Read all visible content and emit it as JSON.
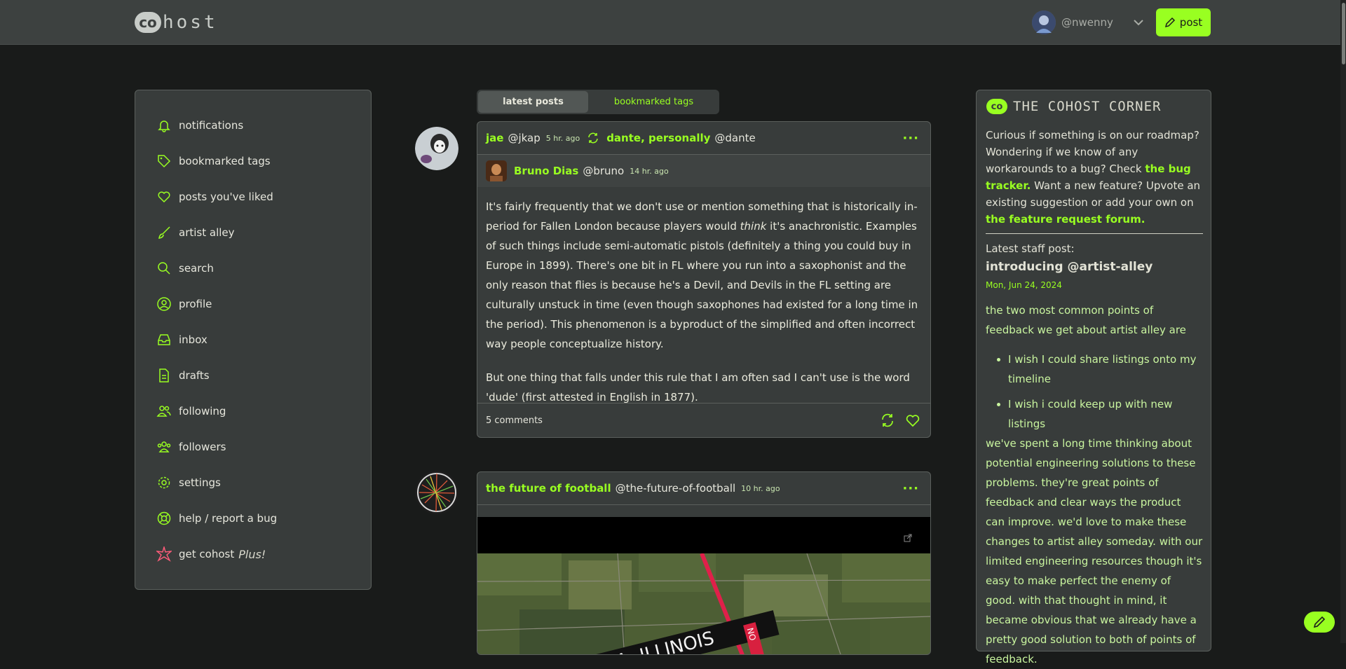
{
  "topbar": {
    "logo_mark": "co",
    "logo_word": "host",
    "username": "@nwenny",
    "post_button": "post"
  },
  "sidebar": {
    "items": [
      {
        "label": "notifications",
        "icon": "bell-icon"
      },
      {
        "label": "bookmarked tags",
        "icon": "tag-icon"
      },
      {
        "label": "posts you've liked",
        "icon": "heart-icon"
      },
      {
        "label": "artist alley",
        "icon": "paintbrush-icon"
      },
      {
        "label": "search",
        "icon": "search-icon"
      },
      {
        "label": "profile",
        "icon": "user-circle-icon"
      },
      {
        "label": "inbox",
        "icon": "inbox-icon"
      },
      {
        "label": "drafts",
        "icon": "document-icon"
      },
      {
        "label": "following",
        "icon": "users-icon"
      },
      {
        "label": "followers",
        "icon": "user-group-icon"
      },
      {
        "label": "settings",
        "icon": "gear-icon"
      },
      {
        "label": "help / report a bug",
        "icon": "lifebuoy-icon"
      },
      {
        "label": "get cohost",
        "suffix": "Plus!",
        "icon": "sparkle-icon"
      }
    ]
  },
  "feed_tabs": {
    "latest": "latest posts",
    "bookmarked": "bookmarked tags"
  },
  "posts": [
    {
      "sharer_name": "jae",
      "sharer_handle": "@jkap",
      "sharer_time": "5 hr. ago",
      "share_target_name": "dante, personally",
      "share_target_handle": "@dante",
      "author_name": "Bruno Dias",
      "author_handle": "@bruno",
      "author_time": "14 hr. ago",
      "para1_a": "It's fairly frequently that we don't use or mention something that is historically in-period for Fallen London because players would ",
      "para1_em": "think",
      "para1_b": " it's anachronistic. Examples of such things include semi-automatic pistols (definitely a thing you could buy in Europe in 1899). There's one bit in FL where you run into a saxophonist and the only reason that flies is because he's a Devil, and Devils in the FL setting are culturally unstuck in time (even though saxophones had existed for a long time in the period). This phenomenon is a byproduct of the simplified and often incorrect way people conceptualize history.",
      "para2": "But one thing that falls under this rule that I am often sad I can't use is the word 'dude' (first attested in English in 1877).",
      "comments": "5 comments"
    },
    {
      "author_name": "the future of football",
      "author_handle": "@the-future-of-football",
      "author_time": "10 hr. ago",
      "map_label": "UKA, ILLINOIS",
      "map_sign": "NO"
    }
  ],
  "corner": {
    "title_mark": "co",
    "title": "THE COHOST CORNER",
    "intro_1": "Curious if something is on our roadmap? Wondering if we know of any workarounds to a bug? Check ",
    "bug_link": "the bug tracker.",
    "intro_2": " Want a new feature? Upvote an existing suggestion or add your own on ",
    "forum_link": "the feature request forum.",
    "latest_label": "Latest staff post:",
    "staff_title": "introducing @artist-alley",
    "staff_date": "Mon, Jun 24, 2024",
    "p1": "the two most common points of feedback we get about artist alley are",
    "bullet1": "I wish I could share listings onto my timeline",
    "bullet2": "I wish i could keep up with new listings",
    "p2": "we've spent a long time thinking about potential engineering solutions to these problems. they're great points of feedback and clear ways the product can improve. we'd love to make these changes to artist alley someday. with our limited engineering resources though it's easy to make perfect the enemy of good. with that thought in mind, it became obvious that we already have a pretty good solution to both of points of feedback."
  },
  "colors": {
    "accent": "#99ff21",
    "background": "#191b1a",
    "panel": "#383c3b",
    "topbar": "#3d4140"
  }
}
